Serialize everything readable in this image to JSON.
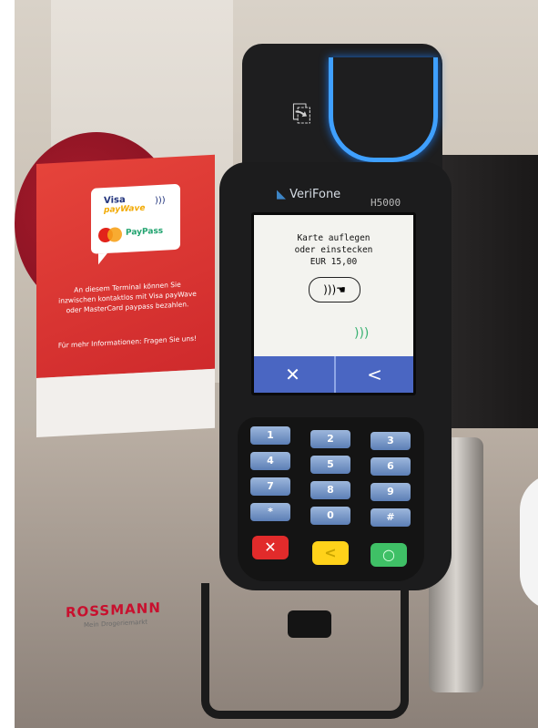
{
  "flyer": {
    "brand_visa": "Visa",
    "brand_visa_sub": "payWave",
    "brand_mc": "PayPass",
    "text_block_1": "An diesem Terminal können Sie inzwischen kontaktlos mit Visa payWave oder MasterCard paypass bezahlen.",
    "text_block_2": "Für mehr Informationen: Fragen Sie uns!",
    "store_name": "ROSSMANN",
    "store_tagline": "Mein Drogeriemarkt"
  },
  "terminal": {
    "logo": "VeriFone",
    "model": "H5000",
    "screen": {
      "line1": "Karte auflegen",
      "line2": "oder einstecken",
      "line3": "EUR 15,00",
      "cancel_symbol": "✕",
      "back_symbol": "<"
    },
    "keys": [
      {
        "label": "1"
      },
      {
        "label": "2"
      },
      {
        "label": "3"
      },
      {
        "label": "4"
      },
      {
        "label": "5"
      },
      {
        "label": "6"
      },
      {
        "label": "7"
      },
      {
        "label": "8"
      },
      {
        "label": "9"
      },
      {
        "label": "*"
      },
      {
        "label": "0"
      },
      {
        "label": "#"
      }
    ],
    "function_keys": {
      "cancel": "✕",
      "correction": "<",
      "confirm": "○"
    }
  },
  "colors": {
    "screen_softbar": "#4a66c2",
    "slot_glow": "#3fa0ff",
    "flyer_red": "#cf2a2c",
    "rossmann_red": "#c8102e"
  }
}
